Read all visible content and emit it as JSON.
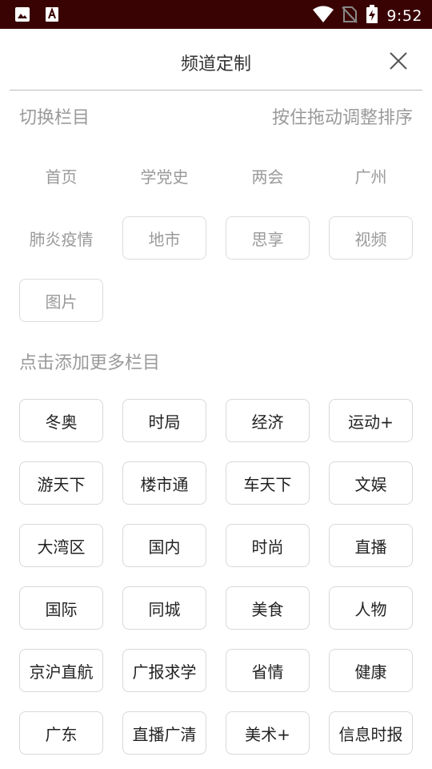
{
  "status_bar": {
    "time": "9:52",
    "icons": [
      "image-icon",
      "text-a-icon",
      "wifi-icon",
      "no-sim-icon",
      "battery-charging-icon"
    ],
    "bg_color": "#3a0303"
  },
  "header": {
    "title": "频道定制",
    "close_icon": "close-icon"
  },
  "my_channels": {
    "title": "切换栏目",
    "hint": "按住拖动调整排序",
    "fixed": [
      "首页",
      "学党史",
      "两会",
      "广州",
      "肺炎疫情"
    ],
    "items": [
      "地市",
      "思享",
      "视频",
      "图片"
    ]
  },
  "more_channels": {
    "title": "点击添加更多栏目",
    "items": [
      "冬奥",
      "时局",
      "经济",
      "运动+",
      "游天下",
      "楼市通",
      "车天下",
      "文娱",
      "大湾区",
      "国内",
      "时尚",
      "直播",
      "国际",
      "同城",
      "美食",
      "人物",
      "京沪直航",
      "广报求学",
      "省情",
      "健康",
      "广东",
      "直播广清",
      "美术+",
      "信息时报"
    ]
  }
}
